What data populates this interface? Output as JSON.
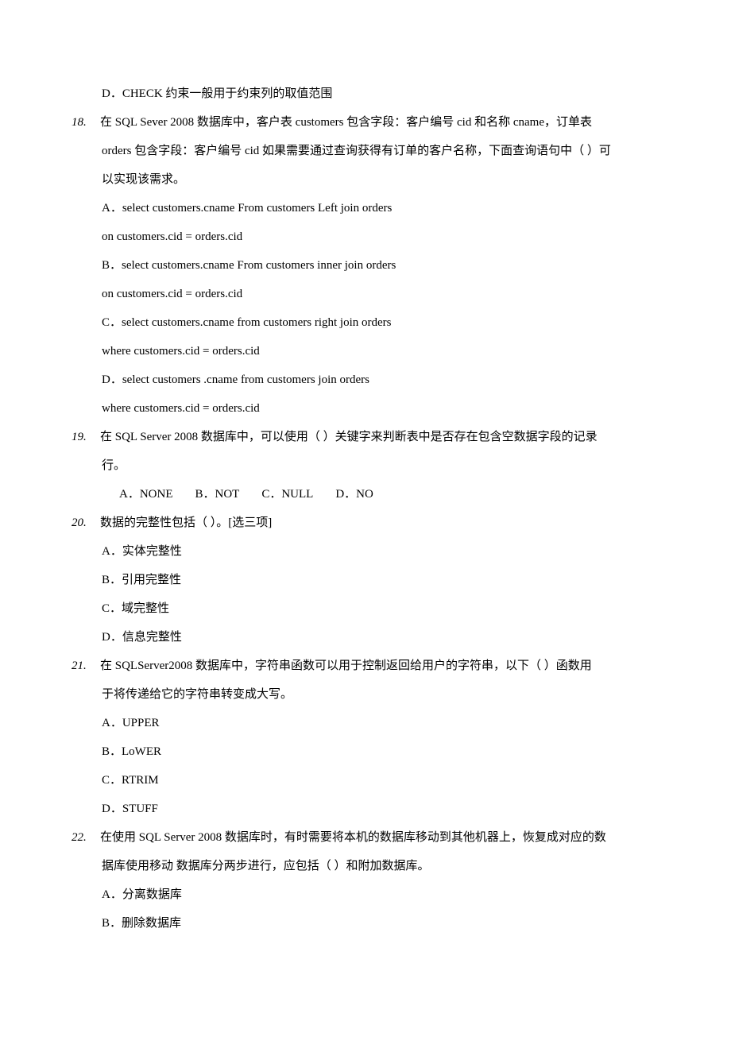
{
  "items": [
    {
      "type": "option",
      "text": "D．CHECK 约束一般用于约束列的取值范围"
    },
    {
      "type": "question",
      "num": "18.",
      "text": "在 SQL Sever 2008 数据库中，客户表 customers 包含字段：客户编号 cid 和名称 cname，订单表"
    },
    {
      "type": "qcontinue",
      "text": "orders 包含字段：客户编号 cid 如果需要通过查询获得有订单的客户名称，下面查询语句中（  ）可"
    },
    {
      "type": "qcontinue",
      "text": "以实现该需求。"
    },
    {
      "type": "option",
      "text": "A．select customers.cname From customers Left join orders"
    },
    {
      "type": "option",
      "text": "on customers.cid = orders.cid"
    },
    {
      "type": "option",
      "text": "B．select customers.cname From customers inner join orders"
    },
    {
      "type": "option",
      "text": "on customers.cid = orders.cid"
    },
    {
      "type": "option",
      "text": "C．select customers.cname from customers right join orders"
    },
    {
      "type": "option",
      "text": "where customers.cid = orders.cid"
    },
    {
      "type": "option",
      "text": "D．select customers .cname from customers join orders"
    },
    {
      "type": "option",
      "text": "where customers.cid = orders.cid"
    },
    {
      "type": "question",
      "num": "19.",
      "text": "在 SQL Server 2008 数据库中，可以使用（  ）关键字来判断表中是否存在包含空数据字段的记录"
    },
    {
      "type": "qcontinue",
      "text": "行。"
    },
    {
      "type": "inline-options",
      "opts": [
        "A．NONE",
        "B．NOT",
        "C．NULL",
        "D．NO"
      ]
    },
    {
      "type": "question",
      "num": "20.",
      "text": "数据的完整性包括（  ）。[选三项]"
    },
    {
      "type": "option",
      "text": "A．实体完整性"
    },
    {
      "type": "option",
      "text": "B．引用完整性"
    },
    {
      "type": "option",
      "text": "C．域完整性"
    },
    {
      "type": "option",
      "text": "D．信息完整性"
    },
    {
      "type": "question",
      "num": "21.",
      "text": "在 SQLServer2008  数据库中，字符串函数可以用于控制返回给用户的字符串，以下（  ）函数用"
    },
    {
      "type": "qcontinue",
      "text": "于将传递给它的字符串转变成大写。"
    },
    {
      "type": "option",
      "text": "A．UPPER"
    },
    {
      "type": "option",
      "text": "B．LoWER"
    },
    {
      "type": "option",
      "text": "C．RTRIM"
    },
    {
      "type": "option",
      "text": "D．STUFF"
    },
    {
      "type": "question",
      "num": "22.",
      "text": "在使用 SQL Server 2008 数据库时，有时需要将本机的数据库移动到其他机器上，恢复成对应的数"
    },
    {
      "type": "qcontinue",
      "text": "据库使用移动 数据库分两步进行，应包括（  ）和附加数据库。"
    },
    {
      "type": "option",
      "text": "A．分离数据库"
    },
    {
      "type": "option",
      "text": "B．删除数据库"
    }
  ]
}
